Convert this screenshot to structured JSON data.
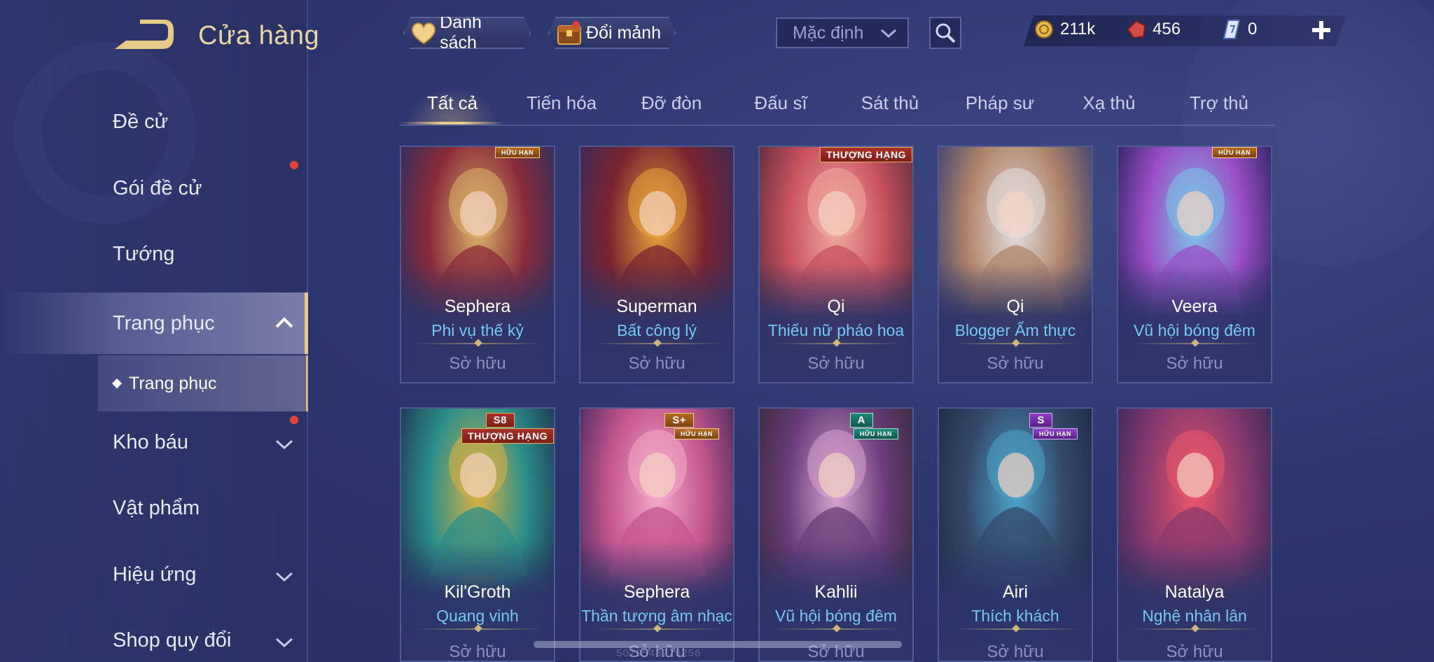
{
  "header": {
    "title": "Cửa hàng",
    "wishlist_label": "Danh sách",
    "fragment_label": "Đổi mảnh",
    "sort_value": "Mặc định"
  },
  "currency": {
    "gold": "211k",
    "vouchers": "456",
    "tickets": "0"
  },
  "sidebar": {
    "items": [
      {
        "label": "Đề cử"
      },
      {
        "label": "Gói đề cử"
      },
      {
        "label": "Tướng"
      },
      {
        "label": "Trang phục"
      },
      {
        "label": "Kho báu"
      },
      {
        "label": "Vật phẩm"
      },
      {
        "label": "Hiệu ứng"
      },
      {
        "label": "Shop quy đổi"
      }
    ],
    "submenu_label": "Trang phục"
  },
  "tabs": [
    "Tất cả",
    "Tiến hóa",
    "Đỡ đòn",
    "Đấu sĩ",
    "Sát thủ",
    "Pháp sư",
    "Xạ thủ",
    "Trợ thủ"
  ],
  "cards": [
    {
      "hero": "Sephera",
      "skin": "Phi vụ thế kỷ",
      "status": "Sở hữu",
      "badge": "HỮU HẠN",
      "palette": [
        "#d9b36a",
        "#8b2b3a",
        "#2b2f5e"
      ]
    },
    {
      "hero": "Superman",
      "skin": "Bất công lý",
      "status": "Sở hữu",
      "badge": "",
      "palette": [
        "#e8a53a",
        "#7a2430",
        "#3a2a5a"
      ]
    },
    {
      "hero": "Qi",
      "skin": "Thiếu nữ pháo hoa",
      "status": "Sở hữu",
      "badge": "THƯỢNG HẠNG",
      "palette": [
        "#f1a9a3",
        "#c9525f",
        "#5d2c3a"
      ]
    },
    {
      "hero": "Qi",
      "skin": "Blogger Ẩm thực",
      "status": "Sở hữu",
      "badge": "",
      "palette": [
        "#e4dede",
        "#b0856a",
        "#3d4070"
      ]
    },
    {
      "hero": "Veera",
      "skin": "Vũ hội bóng đêm",
      "status": "Sở hữu",
      "badge": "HỮU HẠN",
      "palette": [
        "#7cc4e8",
        "#9a4fc7",
        "#2d2360"
      ]
    },
    {
      "hero": "Kil'Groth",
      "skin": "Quang vinh",
      "status": "Sở hữu",
      "badge": "THƯỢNG HẠNG",
      "badge_top": "S8",
      "palette": [
        "#d8b043",
        "#2c8f8a",
        "#1d3450"
      ]
    },
    {
      "hero": "Sephera",
      "skin": "Thần tượng âm nhạc",
      "status": "Sở hữu",
      "badge": "HỮU HẠN",
      "badge_top": "S+",
      "palette": [
        "#f4a9c9",
        "#c4568f",
        "#4b2a5c"
      ]
    },
    {
      "hero": "Kahlii",
      "skin": "Vũ hội bóng đêm",
      "status": "Sở hữu",
      "badge": "HỮU HẠN",
      "badge_top": "A",
      "palette": [
        "#d7a3d0",
        "#6b3d7a",
        "#3b2a3d"
      ]
    },
    {
      "hero": "Airi",
      "skin": "Thích khách",
      "status": "Sở hữu",
      "badge": "HỮU HẠN",
      "badge_top": "S",
      "palette": [
        "#4da3c7",
        "#344a6b",
        "#1d2a44"
      ]
    },
    {
      "hero": "Natalya",
      "skin": "Nghệ nhân lân",
      "status": "Sở hữu",
      "badge": "",
      "palette": [
        "#e9576a",
        "#8b3a6e",
        "#3b2a5a"
      ]
    }
  ],
  "watermark": "5079543776256",
  "icons": [
    "back-icon",
    "heart-icon",
    "chest-icon",
    "chevron-down-icon",
    "search-icon",
    "gold-coin-icon",
    "red-voucher-icon",
    "ticket-icon",
    "plus-icon",
    "chevron-up-icon"
  ]
}
